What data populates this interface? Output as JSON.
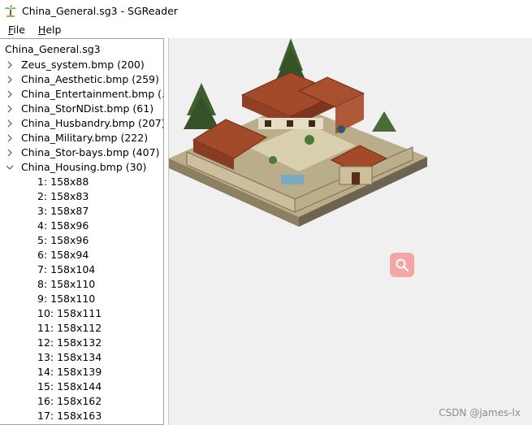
{
  "window": {
    "title": "China_General.sg3 - SGReader"
  },
  "menu": {
    "file": "File",
    "help": "Help"
  },
  "tree": {
    "root": "China_General.sg3",
    "files": [
      {
        "label": "Zeus_system.bmp (200)",
        "expanded": false
      },
      {
        "label": "China_Aesthetic.bmp (259)",
        "expanded": false
      },
      {
        "label": "China_Entertainment.bmp (...",
        "expanded": false
      },
      {
        "label": "China_StorNDist.bmp (61)",
        "expanded": false
      },
      {
        "label": "China_Husbandry.bmp (207)",
        "expanded": false
      },
      {
        "label": "China_Military.bmp (222)",
        "expanded": false
      },
      {
        "label": "China_Stor-bays.bmp (407)",
        "expanded": false
      },
      {
        "label": "China_Housing.bmp (30)",
        "expanded": true
      }
    ],
    "images": [
      "1: 158x88",
      "2: 158x83",
      "3: 158x87",
      "4: 158x96",
      "5: 158x96",
      "6: 158x94",
      "7: 158x104",
      "8: 158x110",
      "9: 158x110",
      "10: 158x111",
      "11: 158x112",
      "12: 158x132",
      "13: 158x134",
      "14: 158x139",
      "15: 158x144",
      "16: 158x162",
      "17: 158x163"
    ]
  },
  "preview": {
    "watermark": "CSDN @james-lx"
  },
  "colors": {
    "roof": "#a24a2a",
    "wall": "#cdbf9c",
    "tree": "#3f5f2f",
    "accent_badge": "#f4a6a6"
  },
  "icons": {
    "app": "palm-tree-icon",
    "zoom": "search-icon",
    "collapsed": "chevron-right-icon",
    "expanded": "chevron-down-icon"
  }
}
